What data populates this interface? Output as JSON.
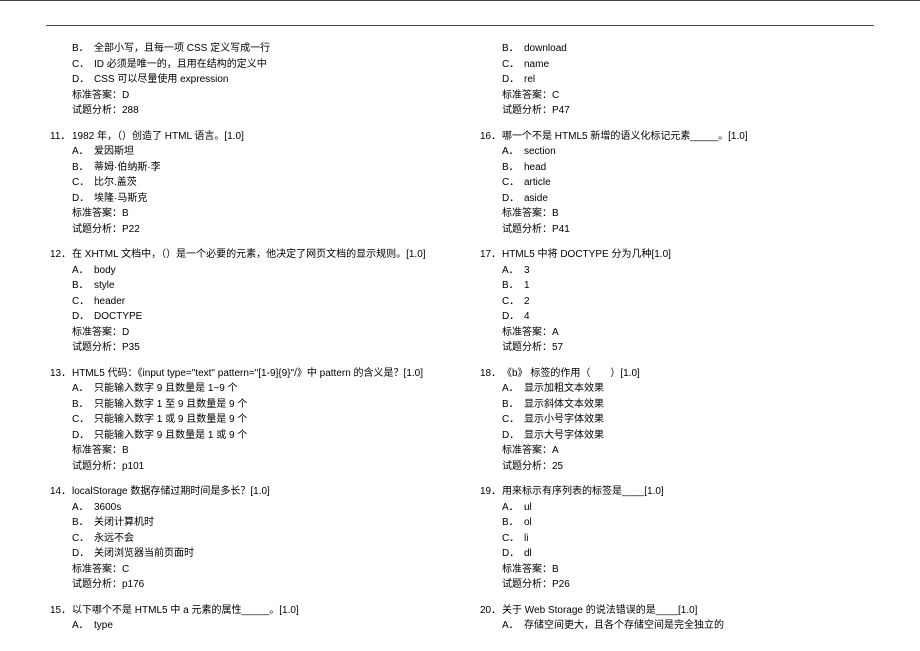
{
  "left": {
    "partial10": {
      "opts": [
        {
          "l": "B．",
          "t": "全部小写，且每一项 CSS 定义写成一行"
        },
        {
          "l": "C．",
          "t": "ID 必须是唯一的，且用在结构的定义中"
        },
        {
          "l": "D．",
          "t": "CSS 可以尽量使用 expression"
        }
      ],
      "ans": "标准答案：D",
      "ana": "试题分析：288"
    },
    "q11": {
      "num": "11．",
      "stem": "1982 年，（）创造了 HTML 语言。[1.0]",
      "opts": [
        {
          "l": "A．",
          "t": "爱因斯坦"
        },
        {
          "l": "B．",
          "t": "蒂姆·伯纳斯·李"
        },
        {
          "l": "C．",
          "t": "比尔.盖茨"
        },
        {
          "l": "D．",
          "t": "埃隆·马斯克"
        }
      ],
      "ans": "标准答案：B",
      "ana": "试题分析：P22"
    },
    "q12": {
      "num": "12．",
      "stem": "在 XHTML 文档中，（）是一个必要的元素，他决定了网页文档的显示规则。[1.0]",
      "opts": [
        {
          "l": "A．",
          "t": "body"
        },
        {
          "l": "B．",
          "t": "style"
        },
        {
          "l": "C．",
          "t": "header"
        },
        {
          "l": "D．",
          "t": "DOCTYPE"
        }
      ],
      "ans": "标准答案：D",
      "ana": "试题分析：P35"
    },
    "q13": {
      "num": "13．",
      "stem": "HTML5 代码：《input type=\"text\" pattern=\"[1-9]{9}\"/》中 pattern 的含义是？[1.0]",
      "opts": [
        {
          "l": "A．",
          "t": "只能输入数字 9 且数量是 1~9 个"
        },
        {
          "l": "B．",
          "t": "只能输入数字 1 至 9 且数量是 9 个"
        },
        {
          "l": "C．",
          "t": "只能输入数字 1 或 9 且数量是 9 个"
        },
        {
          "l": "D．",
          "t": "只能输入数字 9 且数量是 1 或 9 个"
        }
      ],
      "ans": "标准答案：B",
      "ana": "试题分析：p101"
    },
    "q14": {
      "num": "14．",
      "stem": "localStorage 数据存储过期时间是多长？[1.0]",
      "opts": [
        {
          "l": "A．",
          "t": "3600s"
        },
        {
          "l": "B．",
          "t": "关闭计算机时"
        },
        {
          "l": "C．",
          "t": "永远不会"
        },
        {
          "l": "D．",
          "t": "关闭浏览器当前页面时"
        }
      ],
      "ans": "标准答案：C",
      "ana": "试题分析：p176"
    },
    "q15": {
      "num": "15．",
      "stem": "以下哪个不是 HTML5 中 a 元素的属性_____。[1.0]",
      "opts": [
        {
          "l": "A．",
          "t": "type"
        }
      ]
    }
  },
  "right": {
    "partial15": {
      "opts": [
        {
          "l": "B．",
          "t": "download"
        },
        {
          "l": "C．",
          "t": "name"
        },
        {
          "l": "D．",
          "t": "rel"
        }
      ],
      "ans": "标准答案：C",
      "ana": "试题分析：P47"
    },
    "q16": {
      "num": "16．",
      "stem": "哪一个不是 HTML5 新增的语义化标记元素_____。[1.0]",
      "opts": [
        {
          "l": "A．",
          "t": "section"
        },
        {
          "l": "B．",
          "t": "head"
        },
        {
          "l": "C．",
          "t": "article"
        },
        {
          "l": "D．",
          "t": "aside"
        }
      ],
      "ans": "标准答案：B",
      "ana": "试题分析：P41"
    },
    "q17": {
      "num": "17．",
      "stem": "HTML5 中将 DOCTYPE 分为几种[1.0]",
      "opts": [
        {
          "l": "A．",
          "t": "3"
        },
        {
          "l": "B．",
          "t": "1"
        },
        {
          "l": "C．",
          "t": "2"
        },
        {
          "l": "D．",
          "t": "4"
        }
      ],
      "ans": "标准答案：A",
      "ana": "试题分析：57"
    },
    "q18": {
      "num": "18．",
      "stem": "《b》 标签的作用（　　）[1.0]",
      "opts": [
        {
          "l": "A．",
          "t": "显示加粗文本效果"
        },
        {
          "l": "B．",
          "t": "显示斜体文本效果"
        },
        {
          "l": "C．",
          "t": "显示小号字体效果"
        },
        {
          "l": "D．",
          "t": "显示大号字体效果"
        }
      ],
      "ans": "标准答案：A",
      "ana": "试题分析：25"
    },
    "q19": {
      "num": "19．",
      "stem": "用来标示有序列表的标签是____[1.0]",
      "opts": [
        {
          "l": "A．",
          "t": "ul"
        },
        {
          "l": "B．",
          "t": "ol"
        },
        {
          "l": "C．",
          "t": "li"
        },
        {
          "l": "D．",
          "t": "dl"
        }
      ],
      "ans": "标准答案：B",
      "ana": "试题分析：P26"
    },
    "q20": {
      "num": "20．",
      "stem": "关于 Web Storage 的说法错误的是____[1.0]",
      "opts": [
        {
          "l": "A．",
          "t": "存储空间更大，且各个存储空间是完全独立的"
        }
      ]
    }
  }
}
